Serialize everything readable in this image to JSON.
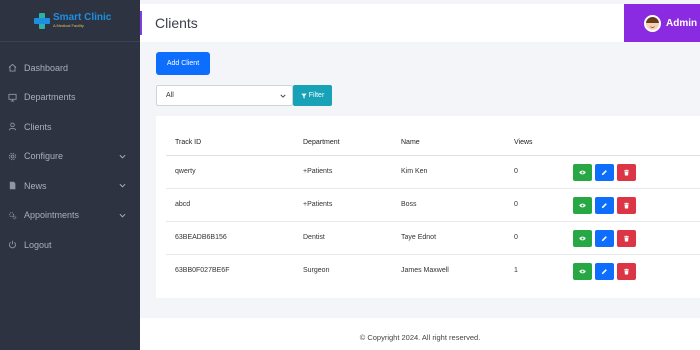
{
  "brand": {
    "name": "Smart Clinic",
    "tagline": "A Medical Facility"
  },
  "sidebar": {
    "items": [
      {
        "label": "Dashboard",
        "icon": "home-icon",
        "has_submenu": false
      },
      {
        "label": "Departments",
        "icon": "monitor-icon",
        "has_submenu": false
      },
      {
        "label": "Clients",
        "icon": "user-icon",
        "has_submenu": false
      },
      {
        "label": "Configure",
        "icon": "gear-icon",
        "has_submenu": true
      },
      {
        "label": "News",
        "icon": "document-icon",
        "has_submenu": true
      },
      {
        "label": "Appointments",
        "icon": "cogs-icon",
        "has_submenu": true
      },
      {
        "label": "Logout",
        "icon": "power-icon",
        "has_submenu": false
      }
    ]
  },
  "header": {
    "title": "Clients",
    "user": "Admin"
  },
  "toolbar": {
    "add_label": "Add Client",
    "filter_value": "All",
    "filter_label": "Filter"
  },
  "table": {
    "columns": [
      "Track ID",
      "Department",
      "Name",
      "Views"
    ],
    "rows": [
      {
        "track_id": "qwerty",
        "department": "+Patients",
        "name": "Kim Ken",
        "views": "0"
      },
      {
        "track_id": "abcd",
        "department": "+Patients",
        "name": "Boss",
        "views": "0"
      },
      {
        "track_id": "63BEADB6B156",
        "department": "Dentist",
        "name": "Taye Ednot",
        "views": "0"
      },
      {
        "track_id": "63BB0F027BE6F",
        "department": "Surgeon",
        "name": "James Maxwell",
        "views": "1"
      }
    ]
  },
  "footer": {
    "copyright": "© Copyright 2024. All right reserved."
  },
  "colors": {
    "sidebar": "#2e3341",
    "accent": "#8a2be2",
    "primary": "#0d6efd",
    "info": "#17a2b8",
    "success": "#28a745",
    "danger": "#dc3545"
  }
}
